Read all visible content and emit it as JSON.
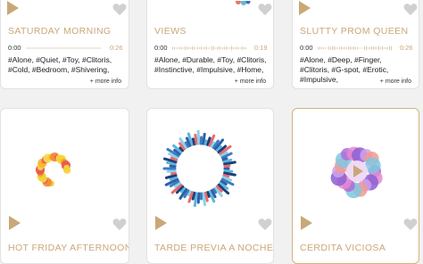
{
  "cards_top": [
    {
      "title": "SATURDAY MORNING",
      "time_start": "0:00",
      "time_end": "0:26",
      "tags": "#Alone, #Quiet, #Toy, #Clitoris, #Cold, #Bedroom, #Shivering,",
      "more_label": "+ more info"
    },
    {
      "title": "VIEWS",
      "time_start": "0:00",
      "time_end": "0:19",
      "tags": "#Alone, #Durable, #Toy, #Clitoris, #Instinctive, #Impulsive, #Home,",
      "more_label": "+ more info"
    },
    {
      "title": "SLUTTY PROM QUEEN",
      "time_start": "0:00",
      "time_end": "0:26",
      "tags": "#Alone, #Deep, #Finger, #Clitoris, #G-spot, #Erotic, #Impulsive,",
      "more_label": "+ more info"
    }
  ],
  "cards_bottom": [
    {
      "title": "HOT FRIDAY AFTERNOON",
      "selected": false
    },
    {
      "title": "TARDE PREVIA A NOCHE DE SEXO",
      "selected": false
    },
    {
      "title": "CERDITA VICIOSA",
      "selected": true
    }
  ],
  "colors": {
    "accent": "#c9a878",
    "heart": "#d0d0d0",
    "background": "#f1f1f1"
  },
  "icons": [
    "play-icon",
    "heart-icon",
    "waveform"
  ]
}
